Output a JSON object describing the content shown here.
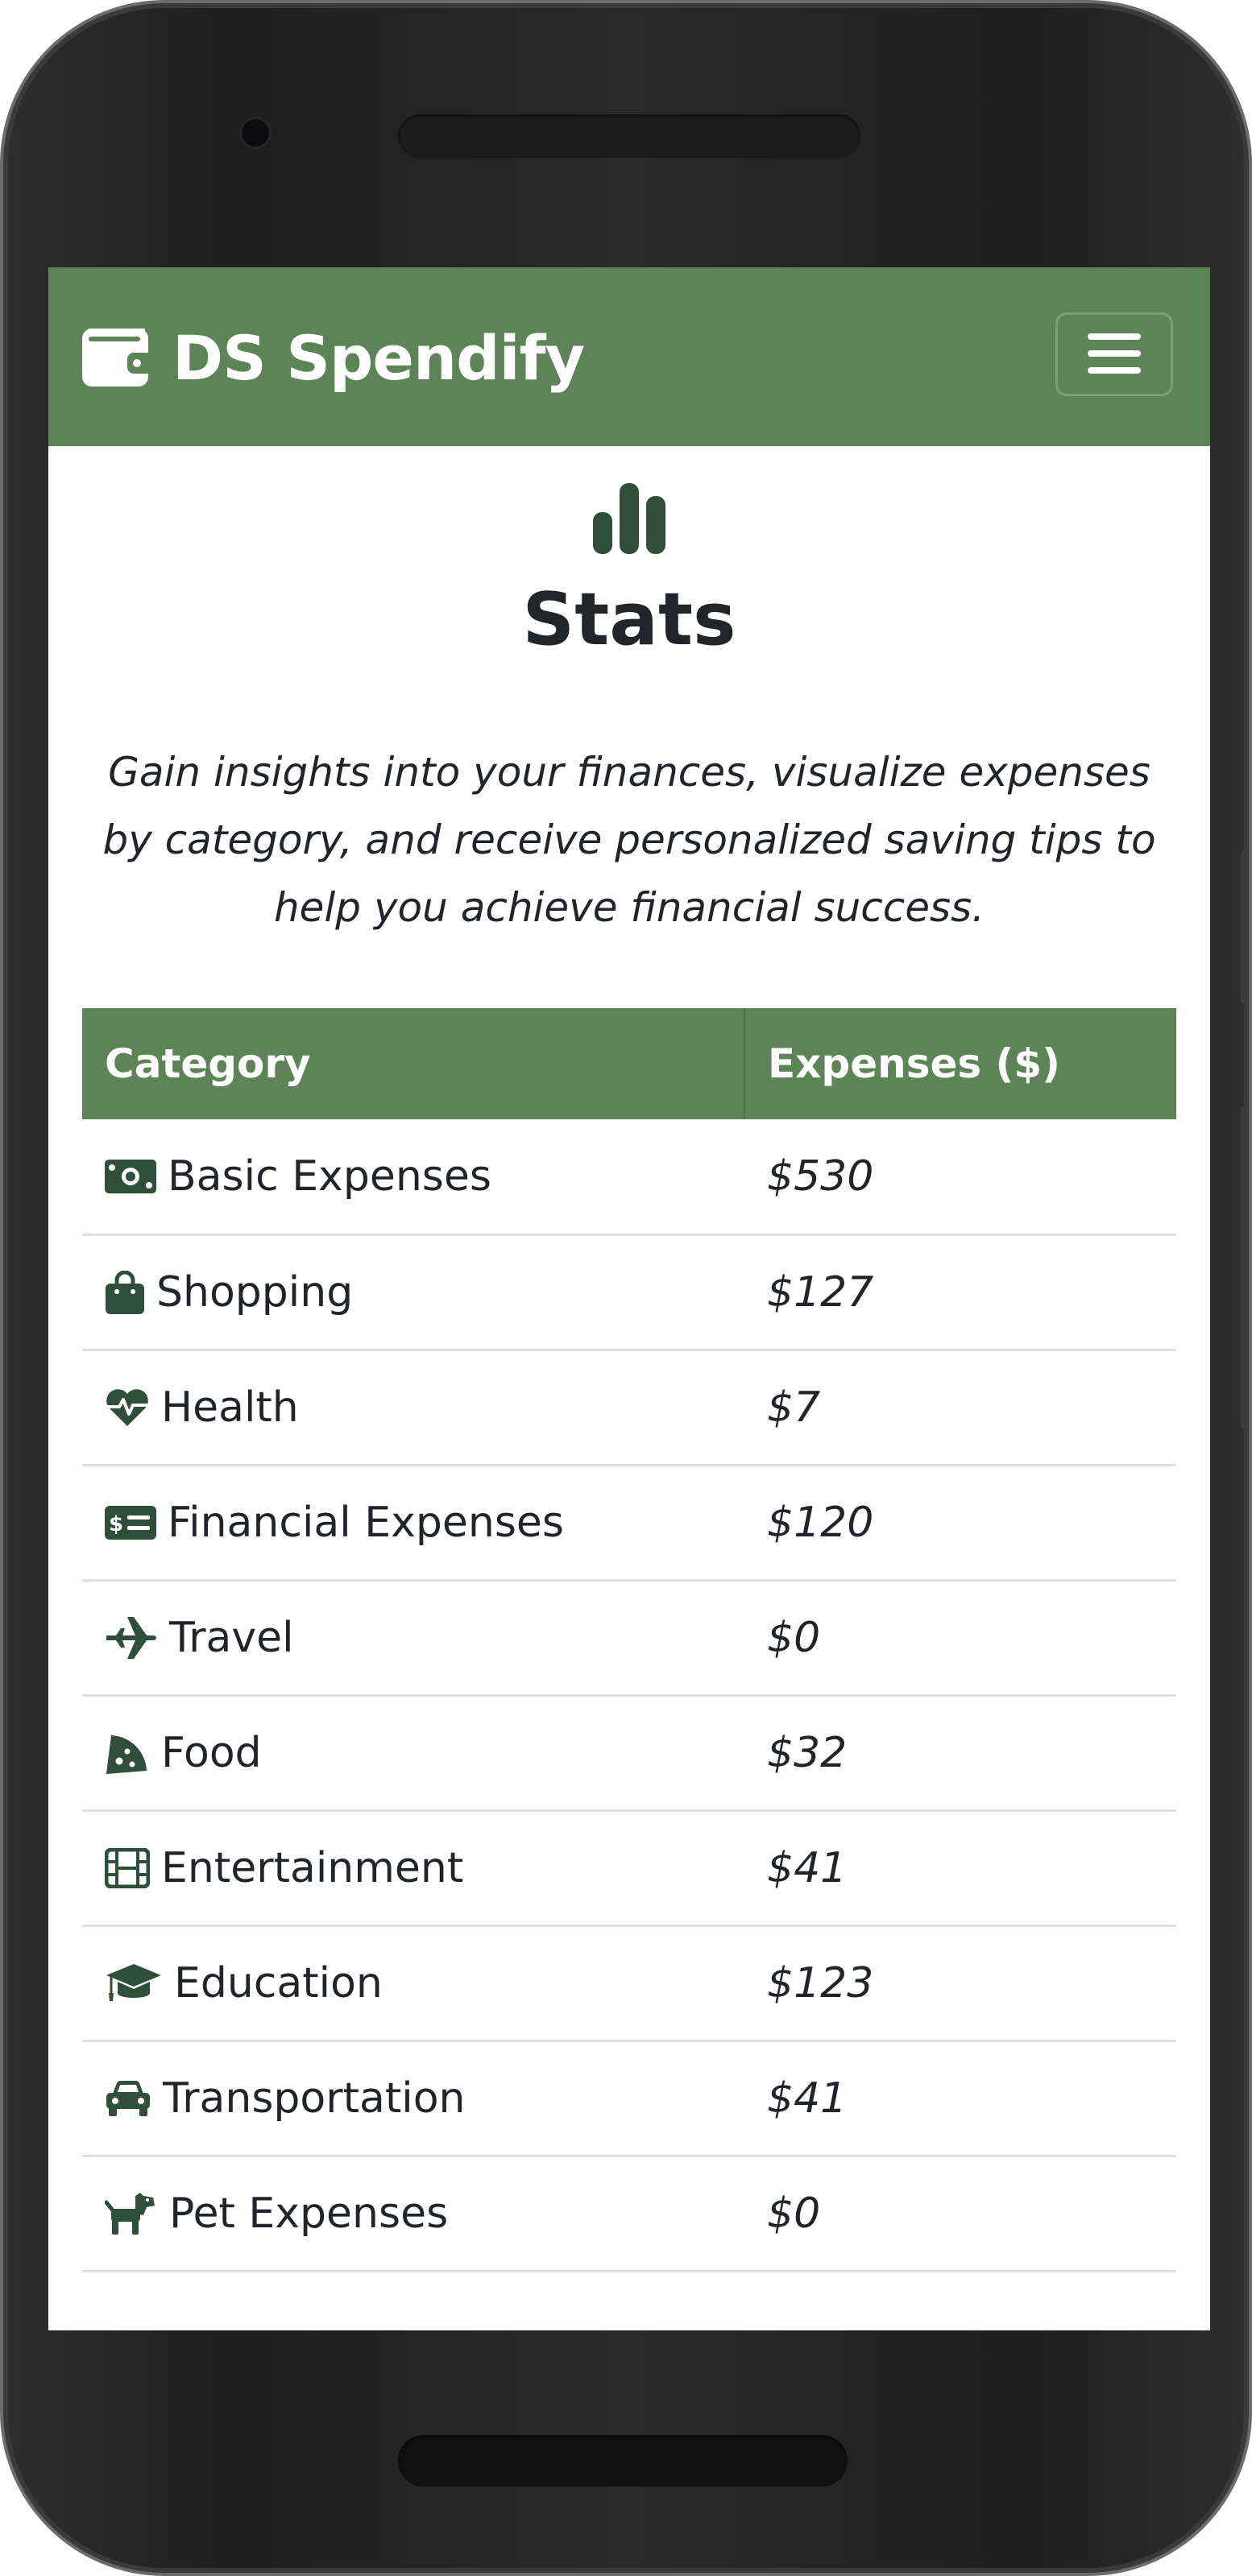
{
  "app": {
    "brand": "DS Spendify",
    "brand_icon": "wallet-icon",
    "menu_icon": "hamburger-menu-icon"
  },
  "page": {
    "icon": "bar-chart-icon",
    "title": "Stats",
    "intro": "Gain insights into your finances, visualize expenses by category, and receive personalized saving tips to help you achieve financial success."
  },
  "table": {
    "headers": [
      "Category",
      "Expenses ($)"
    ],
    "rows": [
      {
        "icon": "money-bill-icon",
        "category": "Basic Expenses",
        "amount": "$530"
      },
      {
        "icon": "shopping-bag-icon",
        "category": "Shopping",
        "amount": "$127"
      },
      {
        "icon": "heart-pulse-icon",
        "category": "Health",
        "amount": "$7"
      },
      {
        "icon": "money-check-icon",
        "category": "Financial Expenses",
        "amount": "$120"
      },
      {
        "icon": "plane-icon",
        "category": "Travel",
        "amount": "$0"
      },
      {
        "icon": "pizza-slice-icon",
        "category": "Food",
        "amount": "$32"
      },
      {
        "icon": "film-icon",
        "category": "Entertainment",
        "amount": "$41"
      },
      {
        "icon": "graduation-cap-icon",
        "category": "Education",
        "amount": "$123"
      },
      {
        "icon": "car-icon",
        "category": "Transportation",
        "amount": "$41"
      },
      {
        "icon": "dog-icon",
        "category": "Pet Expenses",
        "amount": "$0"
      }
    ]
  },
  "colors": {
    "brand_green": "#5c8457",
    "icon_dark_green": "#2f4f3a",
    "text": "#212529",
    "row_border": "#dee2e6",
    "device_frame": "#1e1e1e"
  }
}
